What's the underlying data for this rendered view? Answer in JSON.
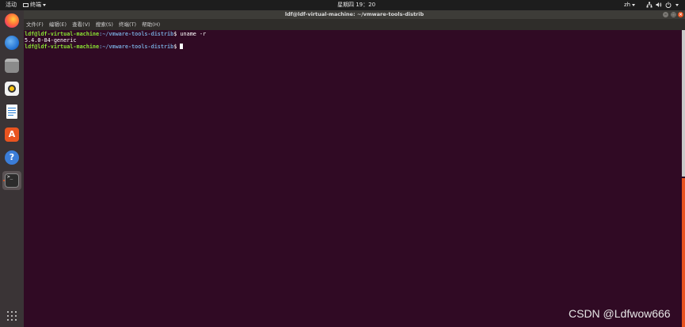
{
  "topbar": {
    "activities": "活动",
    "app_menu": "终端",
    "clock": "星期四 19：20",
    "language": "zh"
  },
  "window": {
    "title": "ldf@ldf-virtual-machine: ~/vmware-tools-distrib"
  },
  "menubar": {
    "items": [
      "文件(F)",
      "编辑(E)",
      "查看(V)",
      "搜索(S)",
      "终端(T)",
      "帮助(H)"
    ]
  },
  "terminal": {
    "lines": [
      {
        "user": "ldf@ldf-virtual-machine",
        "path": ":~/vmware-tools-distrib",
        "suffix": "$ uname -r"
      },
      {
        "output": "5.4.0-84-generic"
      },
      {
        "user": "ldf@ldf-virtual-machine",
        "path": ":~/vmware-tools-distrib",
        "suffix": "$ "
      }
    ]
  },
  "dock": {
    "icons": [
      "firefox-icon",
      "thunderbird-icon",
      "files-icon",
      "rhythmbox-icon",
      "libreoffice-writer-icon",
      "software-center-icon",
      "help-icon",
      "terminal-icon",
      "show-applications-icon"
    ]
  },
  "colors": {
    "terminal_bg": "#300a24",
    "prompt_user": "#8ae234",
    "prompt_path": "#729fcf",
    "accent": "#e95420"
  },
  "watermark": "CSDN @Ldfwow666"
}
